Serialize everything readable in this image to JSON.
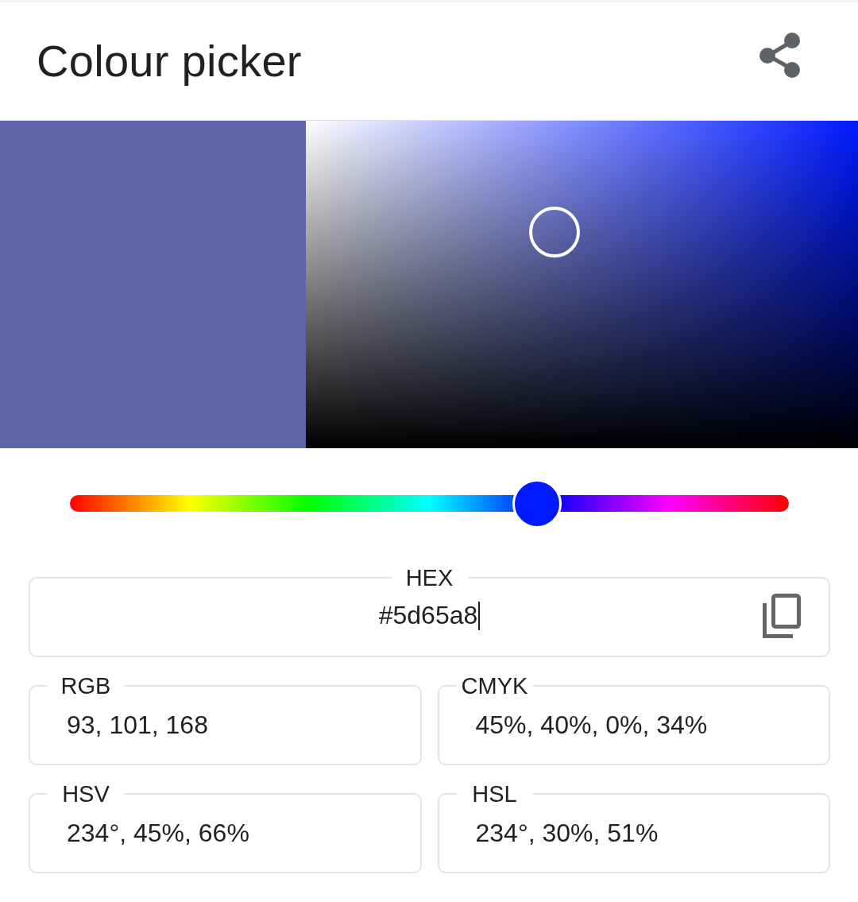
{
  "header": {
    "title": "Colour picker"
  },
  "color_area": {
    "marker_x": {
      "level": 0.45
    },
    "marker_y": {
      "level": 0.66
    }
  },
  "hue_slider": {
    "level": 0.65
  },
  "hex_field": {
    "label": "HEX",
    "value": "#5d65a8",
    "focused": true
  },
  "fields": [
    {
      "label": "RGB",
      "value": "93, 101, 168"
    },
    {
      "label": "CMYK",
      "value": "45%, 40%, 0%, 34%"
    },
    {
      "label": "HSV",
      "value": "234°, 45%, 66%"
    },
    {
      "label": "HSL",
      "value": "234°, 30%, 51%"
    }
  ]
}
